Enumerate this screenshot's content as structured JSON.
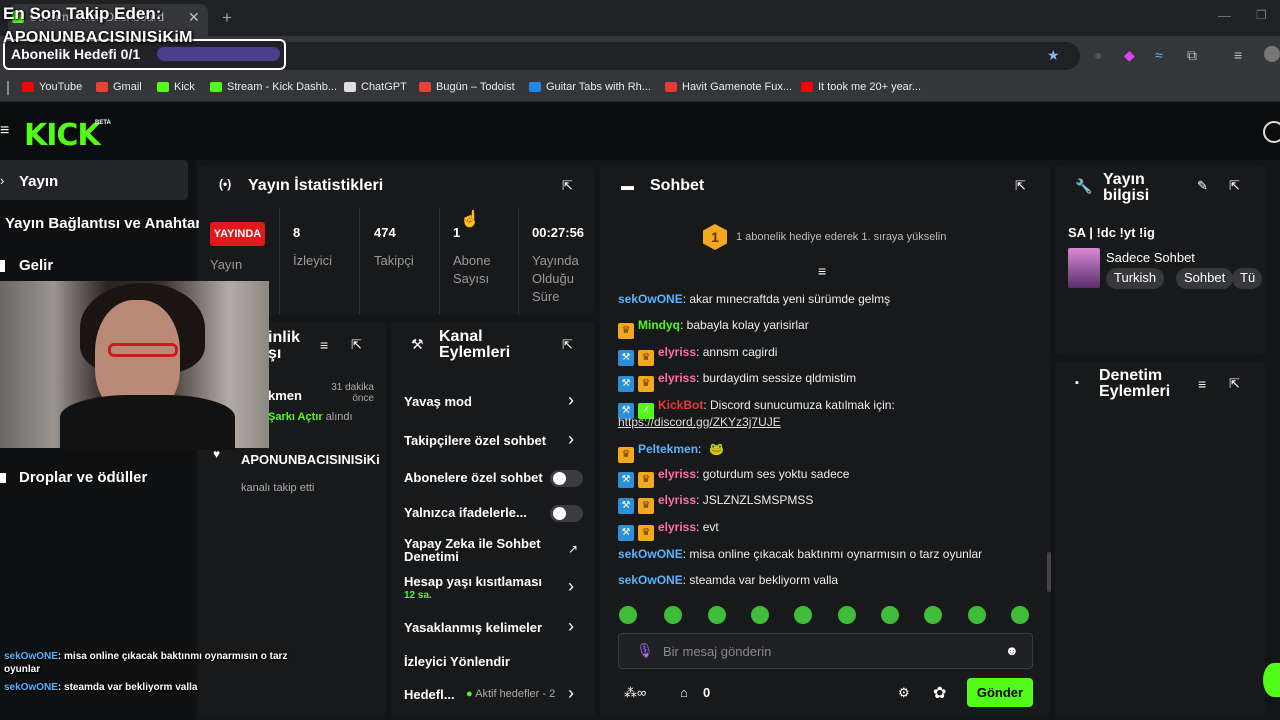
{
  "browser": {
    "tab_title": "Stream - Kick Dashboard",
    "bookmarks": [
      {
        "label": "YouTube",
        "color": "#ff0000"
      },
      {
        "label": "Gmail",
        "color": "#ea4335"
      },
      {
        "label": "Kick",
        "color": "#53fc18"
      },
      {
        "label": "Stream - Kick Dashb...",
        "color": "#53fc18"
      },
      {
        "label": "ChatGPT",
        "color": "#dddddd"
      },
      {
        "label": "Bugün – Todoist",
        "color": "#e44232"
      },
      {
        "label": "Guitar Tabs with Rh...",
        "color": "#1e88e5"
      },
      {
        "label": "Havit Gamenote Fux...",
        "color": "#e53935"
      },
      {
        "label": "It took me 20+ year...",
        "color": "#ff0000"
      }
    ]
  },
  "overlay": {
    "last_follower_title": "En Son Takip Eden:",
    "last_follower_name": "APONUNBACISINISiKiM",
    "sub_goal": "Abonelik Hedefi 0/1",
    "sub_goal_progress": 0,
    "chat": [
      {
        "user": "sekOwONE",
        "text": ": misa online çıkacak baktınmı oynarmısın o tarz",
        "cont": "oyunlar"
      },
      {
        "user": "sekOwONE",
        "text": ": steamda var bekliyorm valla"
      }
    ]
  },
  "kick": {
    "logo": "KICK",
    "beta": "BETA"
  },
  "sidebar": {
    "items": [
      "Yayın",
      "Yayın Bağlantısı ve Anahtarı",
      "Gelir",
      "Droplar ve ödüller"
    ]
  },
  "stats": {
    "title": "Yayın İstatistikleri",
    "live_badge": "YAYINDA",
    "live_label": "Yayın",
    "viewers": "8",
    "viewers_label": "İzleyici",
    "followers": "474",
    "followers_label": "Takipçi",
    "subs": "1",
    "subs_label": "Abone Sayısı",
    "duration": "00:27:56",
    "duration_label": "Yayında Olduğu Süre"
  },
  "activity": {
    "title_part": "inlik",
    "title_part2": "şı",
    "item_user": "kmen",
    "item_time": "31 dakika önce",
    "item_action": "Şarkı Açtır",
    "item_action_suffix": "alındı",
    "follow_user": "APONUNBACISINISiKi",
    "follow_text": "kanalı takip etti"
  },
  "channel_actions": {
    "title": "Kanal Eylemleri",
    "items": [
      {
        "label": "Yavaş mod",
        "type": "chevron"
      },
      {
        "label": "Takipçilere özel sohbet",
        "type": "chevron"
      },
      {
        "label": "Abonelere özel sohbet",
        "type": "toggle"
      },
      {
        "label": "Yalnızca ifadelerle...",
        "type": "toggle"
      },
      {
        "label": "Yapay Zeka ile Sohbet Denetimi",
        "type": "external"
      },
      {
        "label": "Hesap yaşı kısıtlaması",
        "sub": "12 sa.",
        "type": "chevron"
      },
      {
        "label": "Yasaklanmış kelimeler",
        "type": "chevron"
      },
      {
        "label": "İzleyici Yönlendir",
        "type": "none"
      },
      {
        "label": "Hedefl...",
        "sub": "Aktif hedefler - 2",
        "type": "chevron"
      }
    ]
  },
  "chat": {
    "title": "Sohbet",
    "pinned_rank": "1",
    "pinned_text": "1 abonelik hediye ederek 1. sıraya yükselin",
    "messages": [
      {
        "user": "sekOwONE",
        "color": "#5ab4ff",
        "badges": [],
        "text": ": akar mınecraftda yeni sürümde gelmş"
      },
      {
        "user": "Mindyq",
        "color": "#53fc18",
        "badges": [
          "crown"
        ],
        "text": ": babayla kolay yarisirlar"
      },
      {
        "user": "elyriss",
        "color": "#ff6fa8",
        "badges": [
          "mod",
          "crown"
        ],
        "text": ": annsm cagirdi"
      },
      {
        "user": "elyriss",
        "color": "#ff6fa8",
        "badges": [
          "mod",
          "crown"
        ],
        "text": ": burdaydim sessize qldmistim"
      },
      {
        "user": "KickBot",
        "color": "#e53935",
        "badges": [
          "mod",
          "vip"
        ],
        "text": ": Discord sunucumuza katılmak için:",
        "link": "https://discord.gg/ZKYz3j7UJE"
      },
      {
        "user": "Peltekmen",
        "color": "#5ab4ff",
        "badges": [
          "crown"
        ],
        "text": ":"
      },
      {
        "user": "elyriss",
        "color": "#ff6fa8",
        "badges": [
          "mod",
          "crown"
        ],
        "text": ": goturdum ses yoktu sadece"
      },
      {
        "user": "elyriss",
        "color": "#ff6fa8",
        "badges": [
          "mod",
          "crown"
        ],
        "text": ": JSLZNZLSMSPMSS"
      },
      {
        "user": "elyriss",
        "color": "#ff6fa8",
        "badges": [
          "mod",
          "crown"
        ],
        "text": ": evt"
      },
      {
        "user": "sekOwONE",
        "color": "#5ab4ff",
        "badges": [],
        "text": ": misa online çıkacak baktınmı oynarmısın o tarz oyunlar"
      },
      {
        "user": "sekOwONE",
        "color": "#5ab4ff",
        "badges": [],
        "text": ": steamda var bekliyorm valla"
      }
    ],
    "input_placeholder": "Bir mesaj gönderin",
    "count_left": "0",
    "send": "Gönder"
  },
  "stream_info": {
    "title": "Yayın bilgisi",
    "stream_title": "SA | !dc !yt !ig",
    "category": "Sadece Sohbet",
    "tags": [
      "Turkish",
      "Sohbet",
      "Tü"
    ]
  },
  "mod_actions": {
    "title": "Denetim Eylemleri"
  },
  "colors": {
    "accent": "#53fc18",
    "live": "#e0191c"
  }
}
